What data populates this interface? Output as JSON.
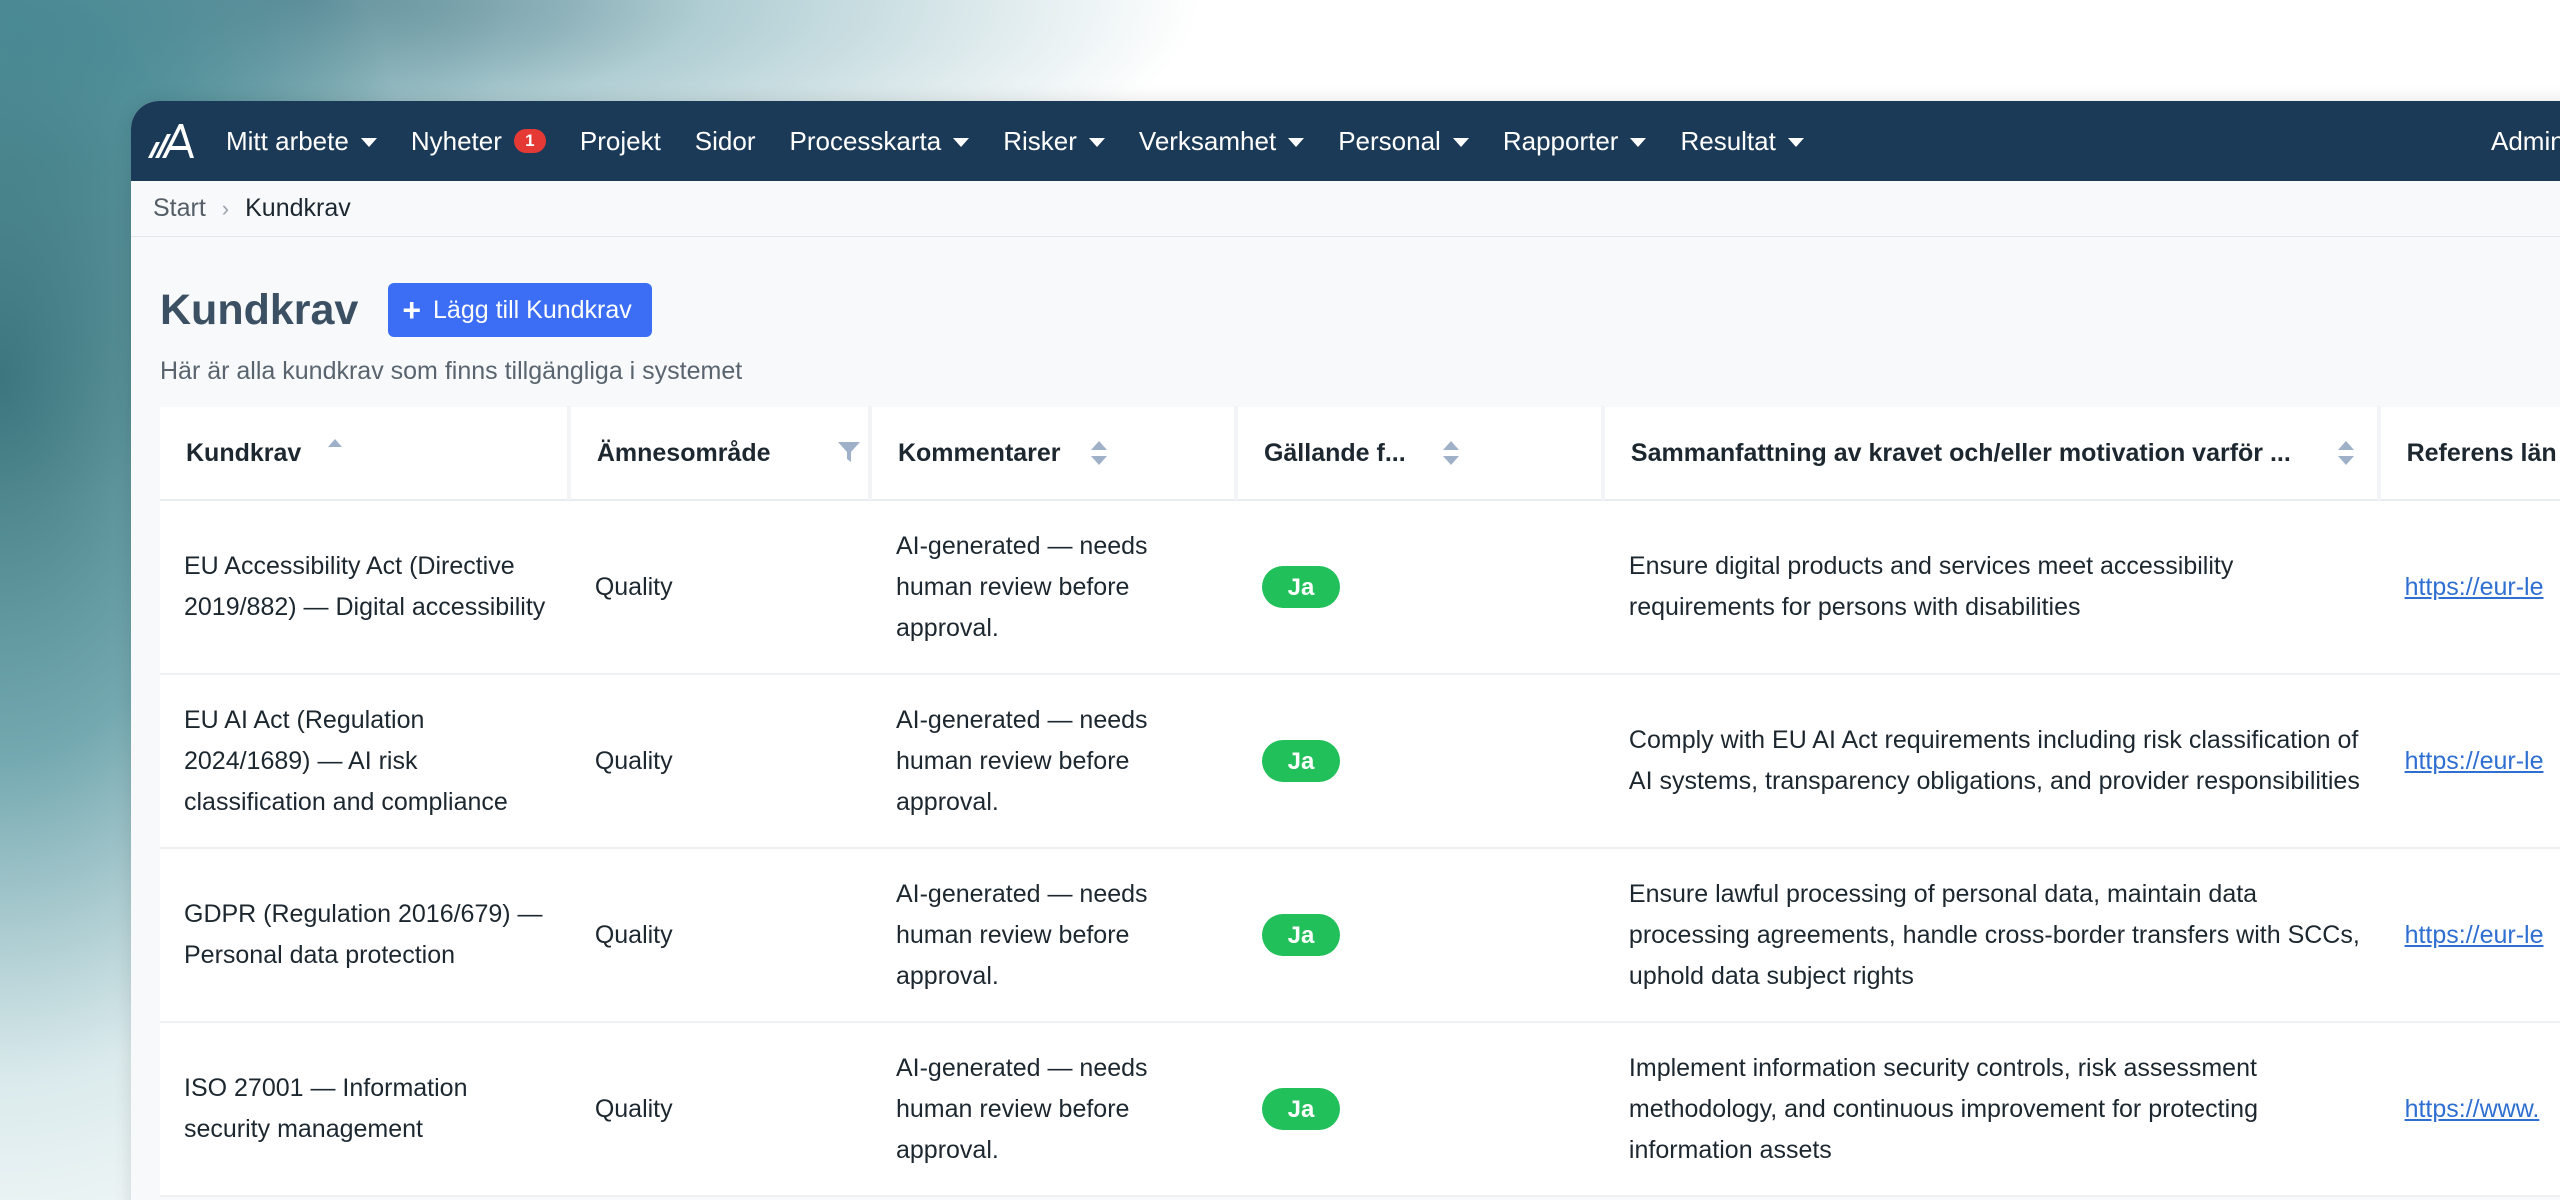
{
  "nav": {
    "items": [
      {
        "label": "Mitt arbete",
        "dropdown": true
      },
      {
        "label": "Nyheter",
        "badge": "1"
      },
      {
        "label": "Projekt"
      },
      {
        "label": "Sidor"
      },
      {
        "label": "Processkarta",
        "dropdown": true
      },
      {
        "label": "Risker",
        "dropdown": true
      },
      {
        "label": "Verksamhet",
        "dropdown": true
      },
      {
        "label": "Personal",
        "dropdown": true
      },
      {
        "label": "Rapporter",
        "dropdown": true
      },
      {
        "label": "Resultat",
        "dropdown": true
      }
    ],
    "right_label": "Admin"
  },
  "breadcrumb": {
    "start": "Start",
    "current": "Kundkrav"
  },
  "header": {
    "title": "Kundkrav",
    "add_button": "Lägg till Kundkrav",
    "subtitle": "Här är alla kundkrav som finns tillgängliga i systemet"
  },
  "table": {
    "columns": [
      "Kundkrav",
      "Ämnesområde",
      "Kommentarer",
      "Gällande f...",
      "Sammanfattning av kravet och/eller motivation varför ...",
      "Referens län"
    ],
    "rows": [
      {
        "kundkrav": "EU Accessibility Act (Directive 2019/882) — Digital accessibility",
        "amne": "Quality",
        "kommentar": "AI-generated — needs human review before approval.",
        "gallande": "Ja",
        "sammanfattning": "Ensure digital products and services meet accessibility requirements for persons with disabilities",
        "referens": "https://eur-le"
      },
      {
        "kundkrav": "EU AI Act (Regulation 2024/1689) — AI risk classification and compliance",
        "amne": "Quality",
        "kommentar": "AI-generated — needs human review before approval.",
        "gallande": "Ja",
        "sammanfattning": "Comply with EU AI Act requirements including risk classification of AI systems, transparency obligations, and provider responsibilities",
        "referens": "https://eur-le"
      },
      {
        "kundkrav": "GDPR (Regulation 2016/679) — Personal data protection",
        "amne": "Quality",
        "kommentar": "AI-generated — needs human review before approval.",
        "gallande": "Ja",
        "sammanfattning": "Ensure lawful processing of personal data, maintain data processing agreements, handle cross-border transfers with SCCs, uphold data subject rights",
        "referens": "https://eur-le"
      },
      {
        "kundkrav": "ISO 27001 — Information security management",
        "amne": "Quality",
        "kommentar": "AI-generated — needs human review before approval.",
        "gallande": "Ja",
        "sammanfattning": "Implement information security controls, risk assessment methodology, and continuous improvement for protecting information assets",
        "referens": "https://www."
      }
    ]
  },
  "colors": {
    "nav_bg": "#1b3a57",
    "primary": "#3b6ef5",
    "success": "#22c05a",
    "badge": "#e53935",
    "link": "#2f6fd1"
  }
}
